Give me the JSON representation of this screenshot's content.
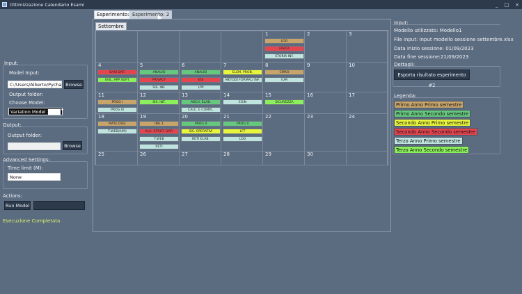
{
  "window": {
    "title": "Ottimizzazione Calendario Esami",
    "min": "_",
    "max": "□",
    "close": "×"
  },
  "left": {
    "input_header": "Input:",
    "model_input_label": "Model Input:",
    "model_input_value": "C:/Users/Alberto/Pycharm",
    "browse1": "Browse",
    "output_folder_label": "Output folder:",
    "choose_model_label": "Choose Model:",
    "model_select": "Variation Model 1",
    "output_header": "Output:",
    "output_folder_label2": "Output folder:",
    "output_folder_value": "",
    "browse2": "Browse",
    "advanced_header": "Advanced Settings:",
    "time_limit_label": "Time limit (M):",
    "time_limit_value": "None",
    "actions_header": "Actions:",
    "run_button": "Run Model",
    "status": "Esecuzione Completata"
  },
  "tabs": [
    {
      "label": "Esperimento: 1"
    },
    {
      "label": "Esperimento: 2"
    }
  ],
  "month": "Settembre",
  "calendar": [
    {
      "day": "",
      "exams": []
    },
    {
      "day": "",
      "exams": []
    },
    {
      "day": "",
      "exams": []
    },
    {
      "day": "",
      "exams": []
    },
    {
      "day": "1",
      "exams": [
        {
          "name": "LOG",
          "c": "c1"
        },
        {
          "name": "FISICA",
          "c": "c4"
        },
        {
          "name": "STORIA INF.",
          "c": "c5"
        }
      ]
    },
    {
      "day": "2",
      "exams": []
    },
    {
      "day": "3",
      "exams": []
    },
    {
      "day": "4",
      "exams": [
        {
          "name": "BASI DATI",
          "c": "c4"
        },
        {
          "name": "SVIL. APP SOFT.",
          "c": "c6"
        }
      ]
    },
    {
      "day": "5",
      "exams": [
        {
          "name": "ANALISI",
          "c": "c2"
        },
        {
          "name": "PRIVACY",
          "c": "c4"
        },
        {
          "name": "SIS. INF.",
          "c": "c5"
        }
      ]
    },
    {
      "day": "6",
      "exams": [
        {
          "name": "ANALISI",
          "c": "c2"
        },
        {
          "name": "EGI",
          "c": "c4"
        },
        {
          "name": "LPP",
          "c": "c5"
        }
      ]
    },
    {
      "day": "7",
      "exams": [
        {
          "name": "ELEM. PROB.",
          "c": "c3"
        },
        {
          "name": "METODI FORMALI INF.",
          "c": "c5"
        }
      ]
    },
    {
      "day": "8",
      "exams": [
        {
          "name": "CMRO",
          "c": "c1"
        },
        {
          "name": "IUM",
          "c": "c5"
        }
      ]
    },
    {
      "day": "9",
      "exams": []
    },
    {
      "day": "10",
      "exams": []
    },
    {
      "day": "11",
      "exams": [
        {
          "name": "PROG I",
          "c": "c1"
        },
        {
          "name": "PROG III",
          "c": "c5"
        }
      ]
    },
    {
      "day": "12",
      "exams": [
        {
          "name": "SIS. INT.",
          "c": "c6"
        }
      ]
    },
    {
      "day": "13",
      "exams": [
        {
          "name": "ARCH. ELAB.",
          "c": "c2"
        },
        {
          "name": "CALC. E COMPL.",
          "c": "c5"
        }
      ]
    },
    {
      "day": "14",
      "exams": [
        {
          "name": "EGIN",
          "c": "c5"
        }
      ]
    },
    {
      "day": "15",
      "exams": [
        {
          "name": "SICUREZZA",
          "c": "c6"
        }
      ]
    },
    {
      "day": "16",
      "exams": []
    },
    {
      "day": "17",
      "exams": []
    },
    {
      "day": "18",
      "exams": [
        {
          "name": "MATE DISC",
          "c": "c1"
        },
        {
          "name": "T.WEB(IUM)",
          "c": "c5"
        }
      ]
    },
    {
      "day": "19",
      "exams": [
        {
          "name": "ING 1",
          "c": "c1"
        },
        {
          "name": "ALG. STRUT. DATI",
          "c": "c4"
        },
        {
          "name": "T.WEB",
          "c": "c5"
        },
        {
          "name": "RETI",
          "c": "c5"
        }
      ]
    },
    {
      "day": "20",
      "exams": [
        {
          "name": "PROG II",
          "c": "c2"
        },
        {
          "name": "SIS. OPERATIVI",
          "c": "c3"
        },
        {
          "name": "RETI ELAB.",
          "c": "c5"
        }
      ]
    },
    {
      "day": "21",
      "exams": [
        {
          "name": "PROG II",
          "c": "c2"
        },
        {
          "name": "LFT",
          "c": "c3"
        },
        {
          "name": "LOG",
          "c": "c5"
        }
      ]
    },
    {
      "day": "22",
      "exams": []
    },
    {
      "day": "23",
      "exams": []
    },
    {
      "day": "24",
      "exams": []
    },
    {
      "day": "25",
      "exams": []
    },
    {
      "day": "26",
      "exams": []
    },
    {
      "day": "27",
      "exams": []
    },
    {
      "day": "28",
      "exams": []
    },
    {
      "day": "29",
      "exams": []
    },
    {
      "day": "30",
      "exams": []
    },
    {
      "day": "",
      "exams": []
    }
  ],
  "right": {
    "input_header": "Input:",
    "model_used": "Modello utilizzato: Modello1",
    "file_input": "File input: Input modello sessione settembre.xlsx",
    "start": "Data inizio sessione: 01/09/2023",
    "end": "Data fine sessione:21/09/2023",
    "details_header": "Dettagli:",
    "export_button": "Esporta risultato esperimento #2",
    "legend_header": "Legenda:",
    "legend": [
      {
        "label": "Primo Anno Primo semestre",
        "color": "#c6a46a"
      },
      {
        "label": "Primo Anno Secondo semestre",
        "color": "#66c87e"
      },
      {
        "label": "Secondo Anno Primo semestre",
        "color": "#e8f53d"
      },
      {
        "label": "Secondo Anno Secondo semestre",
        "color": "#e5454f"
      },
      {
        "label": "Terzo Anno Primo semestre",
        "color": "#bfe4e0"
      },
      {
        "label": "Terzo Anno Secondo semestre",
        "color": "#8bf05c"
      }
    ]
  }
}
